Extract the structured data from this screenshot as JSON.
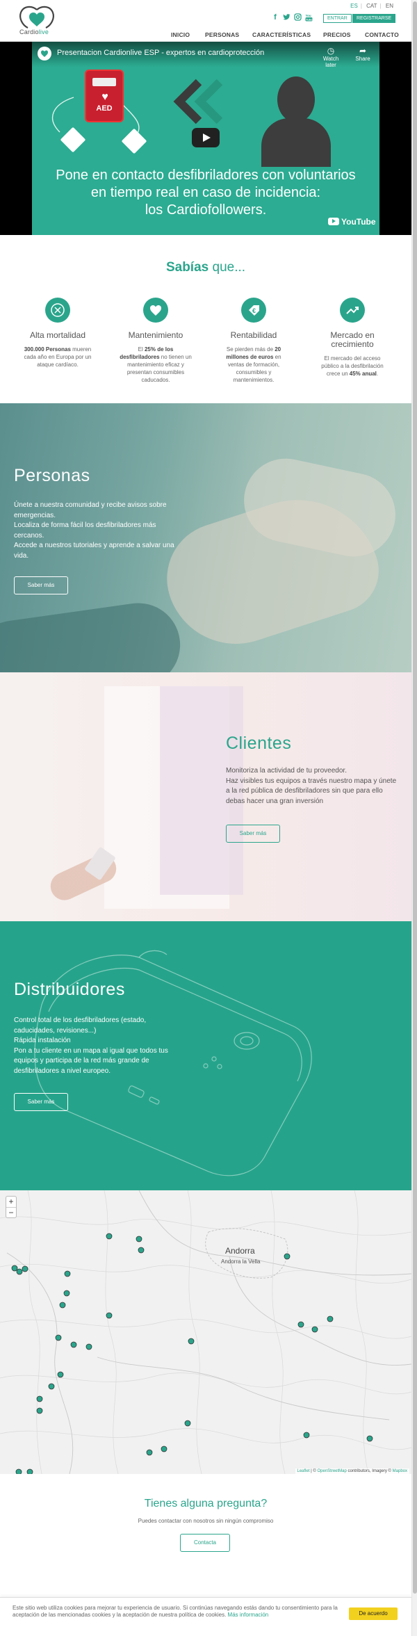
{
  "header": {
    "logo_name": "Cardiolive",
    "logo_accent": "Cardio",
    "logo_rest": "live",
    "languages": [
      "ES",
      "CAT",
      "EN"
    ],
    "active_language": "ES",
    "social_icons": [
      "facebook-icon",
      "twitter-icon",
      "instagram-icon",
      "youtube-icon"
    ],
    "login_label": "ENTRAR",
    "register_label": "REGISTRARSE",
    "nav": [
      "INICIO",
      "PERSONAS",
      "CARACTERÍSTICAS",
      "PRECIOS",
      "CONTACTO"
    ]
  },
  "video": {
    "title": "Presentacion Cardionlive ESP - expertos en cardioprotección",
    "watch_later": "Watch later",
    "share": "Share",
    "aed_label": "AED",
    "caption_line1": "Pone en contacto desfibriladores con voluntarios",
    "caption_line2": "en tiempo real en caso de incidencia:",
    "caption_line3": "los Cardiofollowers.",
    "youtube_label": "YouTube"
  },
  "sabias": {
    "title_bold": "Sabías",
    "title_rest": " que...",
    "features": [
      {
        "icon": "x-icon",
        "title": "Alta mortalidad",
        "pre": "",
        "bold": "300.000 Personas",
        "post": " mueren cada año en Europa por un ataque cardíaco."
      },
      {
        "icon": "heart-icon",
        "title": "Mantenimiento",
        "pre": "El ",
        "bold": "25% de los desfibriladores",
        "post": " no tienen un mantenimiento eficaz y presentan consumibles caducados."
      },
      {
        "icon": "euro-icon",
        "title": "Rentabilidad",
        "pre": "Se pierden más de ",
        "bold": "20 millones de euros",
        "post": " en ventas de formación, consumibles y mantenimientos."
      },
      {
        "icon": "trend-up-icon",
        "title": "Mercado en crecimiento",
        "pre": "El mercado del acceso público a la desfibrilación crece un ",
        "bold": "45% anual",
        "post": "."
      }
    ]
  },
  "personas": {
    "title": "Personas",
    "lines": [
      "Únete a nuestra comunidad y recibe avisos sobre emergencias.",
      "Localiza de forma fácil los desfibriladores más cercanos.",
      "Accede a nuestros tutoriales y aprende a salvar una vida."
    ],
    "button": "Saber más"
  },
  "clientes": {
    "title": "Clientes",
    "lines": [
      "Monitoriza la actividad de tu proveedor.",
      "Haz visibles tus equipos a través nuestro mapa y únete a la red pública de desfibriladores sin que para ello debas hacer una gran inversión"
    ],
    "button": "Saber más"
  },
  "distribuidores": {
    "title": "Distribuidores",
    "lines": [
      "Control total de los desfibriladores (estado, caducidades, revisiones...)",
      "Rápida instalación",
      "Pon a tu cliente en un mapa al igual que todos tus equipos y participa de la red más grande de desfibriladores a nivel europeo."
    ],
    "button": "Saber más"
  },
  "map": {
    "zoom_in": "+",
    "zoom_out": "−",
    "country_label": "Andorra",
    "city_label": "Andorra la Vella",
    "attribution_leaflet": "Leaflet",
    "attribution_osm": "OpenStreetMap",
    "attribution_mid": " contributors, Imagery © ",
    "attribution_mapbox": "Mapbox",
    "attribution_sep": " | © "
  },
  "contact": {
    "title": "Tienes alguna pregunta?",
    "subtitle": "Puedes contactar con nosotros sin ningún compromiso",
    "button": "Contacta"
  },
  "cookie": {
    "text": "Este sitio web utiliza cookies para mejorar tu experiencia de usuario. Si continúas navegando estás dando tu consentimiento para la aceptación de las mencionadas cookies y la aceptación de nuestra política de cookies. ",
    "link": "Más información",
    "button": "De acuerdo"
  },
  "colors": {
    "accent": "#2aa58c",
    "cookie_button": "#f2d01e"
  }
}
